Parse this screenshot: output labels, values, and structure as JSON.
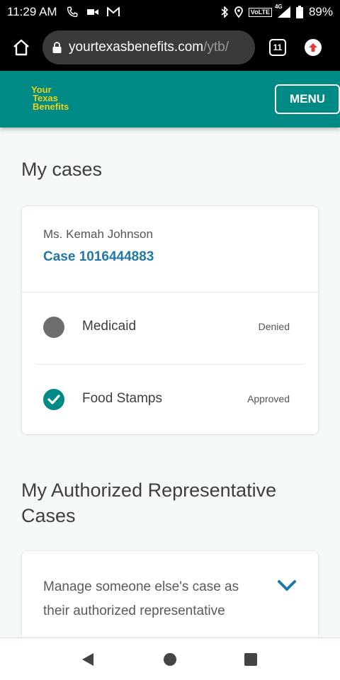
{
  "status_bar": {
    "time": "11:29 AM",
    "network": "VoLTE",
    "network_gen": "4G",
    "battery": "89%"
  },
  "browser": {
    "url_domain": "yourtexasbenefits.com",
    "url_path": "/ytb/",
    "tab_count": "11"
  },
  "header": {
    "logo_lines": [
      "Your",
      "Texas",
      "Benefits"
    ],
    "menu_label": "MENU",
    "brand_color": "#008a86"
  },
  "cases": {
    "title": "My cases",
    "client_name": "Ms. Kemah Johnson",
    "case_label": "Case 1016444883",
    "benefits": [
      {
        "name": "Medicaid",
        "status": "Denied",
        "icon": "gray-circle-icon"
      },
      {
        "name": "Food Stamps",
        "status": "Approved",
        "icon": "check-circle-icon"
      }
    ]
  },
  "authorized": {
    "title": "My Authorized Representative Cases",
    "manage_text": "Manage someone else's case as their authorized representative"
  }
}
